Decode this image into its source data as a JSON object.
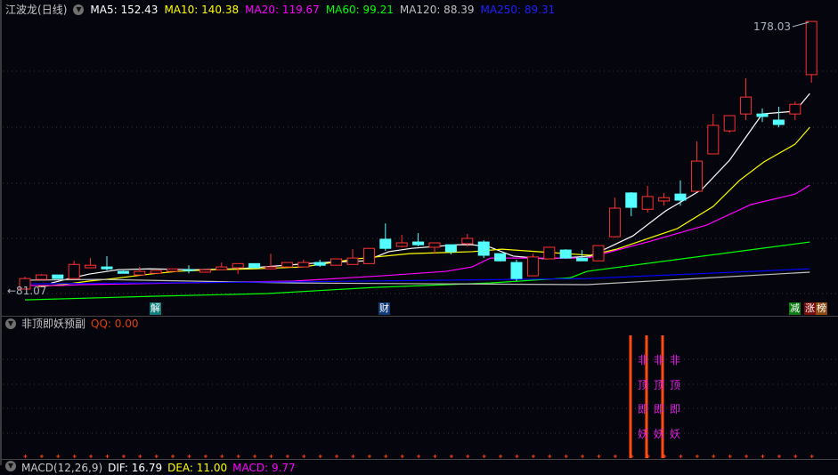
{
  "header": {
    "stock_name": "江波龙",
    "period": "(日线)",
    "ma": [
      {
        "label": "MA5: 152.43",
        "color": "#ffffff"
      },
      {
        "label": "MA10: 140.38",
        "color": "#ffff00"
      },
      {
        "label": "MA20: 119.67",
        "color": "#ff00ff"
      },
      {
        "label": "MA60: 99.21",
        "color": "#00ff00"
      },
      {
        "label": "MA120: 88.39",
        "color": "#c0c0c0"
      },
      {
        "label": "MA250: 89.31",
        "color": "#0000ff"
      }
    ]
  },
  "markers": {
    "jie": "解",
    "cai": "财",
    "jian": "减",
    "zhang": "涨",
    "bang": "榜"
  },
  "chart_data": {
    "type": "candlestick",
    "price_range": [
      77,
      180
    ],
    "high_label": "178.03",
    "low_label": "81.07",
    "up_color": "#ff3232",
    "down_color": "#54ffff",
    "candles": [
      [
        81.4,
        85.9,
        81.1,
        85.2
      ],
      [
        84.9,
        86.8,
        84.9,
        86.5
      ],
      [
        86.5,
        86.5,
        85.2,
        85.2
      ],
      [
        85.2,
        91.6,
        84.9,
        90.3
      ],
      [
        89.1,
        92.6,
        89.1,
        90.0
      ],
      [
        89.4,
        93.3,
        88.1,
        88.7
      ],
      [
        87.8,
        88.1,
        87.1,
        87.1
      ],
      [
        86.5,
        89.4,
        86.5,
        87.8
      ],
      [
        87.1,
        88.1,
        87.1,
        88.1
      ],
      [
        87.8,
        88.7,
        87.8,
        88.7
      ],
      [
        88.4,
        90.0,
        87.1,
        88.1
      ],
      [
        87.5,
        88.4,
        87.5,
        88.4
      ],
      [
        88.4,
        91.0,
        88.4,
        89.4
      ],
      [
        89.1,
        90.6,
        86.8,
        90.6
      ],
      [
        90.6,
        90.6,
        89.1,
        89.1
      ],
      [
        88.7,
        94.2,
        88.7,
        89.4
      ],
      [
        89.4,
        91.0,
        89.4,
        91.0
      ],
      [
        89.4,
        92.0,
        89.4,
        91.0
      ],
      [
        91.0,
        92.0,
        89.4,
        90.0
      ],
      [
        90.0,
        92.3,
        90.0,
        92.3
      ],
      [
        90.3,
        95.8,
        90.3,
        92.6
      ],
      [
        90.6,
        96.1,
        90.6,
        96.1
      ],
      [
        99.4,
        105.1,
        95.2,
        96.1
      ],
      [
        96.8,
        101.0,
        96.5,
        98.1
      ],
      [
        98.4,
        101.6,
        96.8,
        97.4
      ],
      [
        96.5,
        98.1,
        94.2,
        98.1
      ],
      [
        97.4,
        97.4,
        93.9,
        94.9
      ],
      [
        97.8,
        101.3,
        96.8,
        99.7
      ],
      [
        98.4,
        99.0,
        92.6,
        93.6
      ],
      [
        94.2,
        94.2,
        91.3,
        91.6
      ],
      [
        91.0,
        92.0,
        84.3,
        85.2
      ],
      [
        86.2,
        94.2,
        86.2,
        93.0
      ],
      [
        92.3,
        96.5,
        92.3,
        96.5
      ],
      [
        95.5,
        95.8,
        92.3,
        92.6
      ],
      [
        92.6,
        95.5,
        91.6,
        91.6
      ],
      [
        91.6,
        97.1,
        91.6,
        97.1
      ],
      [
        100.3,
        114.4,
        100.0,
        110.6
      ],
      [
        116.1,
        116.4,
        107.7,
        110.9
      ],
      [
        110.2,
        118.6,
        109.0,
        114.8
      ],
      [
        113.2,
        116.1,
        111.5,
        114.4
      ],
      [
        115.7,
        120.6,
        111.5,
        113.5
      ],
      [
        116.7,
        134.7,
        116.7,
        127.6
      ],
      [
        130.2,
        144.6,
        130.2,
        140.5
      ],
      [
        138.5,
        144.0,
        137.9,
        144.0
      ],
      [
        144.6,
        157.5,
        142.4,
        150.7
      ],
      [
        144.6,
        146.6,
        141.7,
        143.7
      ],
      [
        142.4,
        147.2,
        139.8,
        140.8
      ],
      [
        144.6,
        149.1,
        142.4,
        148.1
      ],
      [
        158.8,
        178.03,
        155.9,
        178.0
      ]
    ],
    "ma_series": [
      {
        "name": "MA5",
        "color": "#ffffff",
        "points": [
          [
            1.6,
            83.6
          ],
          [
            2.7,
            85.2
          ],
          [
            3.9,
            86.8
          ],
          [
            5.7,
            88.4
          ],
          [
            7.6,
            88.7
          ],
          [
            10.4,
            88.4
          ],
          [
            13,
            88.7
          ],
          [
            16.6,
            90.3
          ],
          [
            18.2,
            91.0
          ],
          [
            20.8,
            91.6
          ],
          [
            22.2,
            94.9
          ],
          [
            23.6,
            96.1
          ],
          [
            26.4,
            97.4
          ],
          [
            27.3,
            97.4
          ],
          [
            28.4,
            96.5
          ],
          [
            29.8,
            93.3
          ],
          [
            31.8,
            92.3
          ],
          [
            34.5,
            93.3
          ],
          [
            37.1,
            100.6
          ],
          [
            39.1,
            109.6
          ],
          [
            41.3,
            117.3
          ],
          [
            43,
            127.9
          ],
          [
            45,
            144.6
          ],
          [
            47,
            145.6
          ],
          [
            47.9,
            152.0
          ]
        ]
      },
      {
        "name": "MA10",
        "color": "#ffff00",
        "points": [
          [
            0.8,
            82.3
          ],
          [
            2.3,
            83.0
          ],
          [
            3.9,
            84.3
          ],
          [
            5.4,
            85.2
          ],
          [
            7.6,
            86.8
          ],
          [
            9.3,
            87.8
          ],
          [
            11.5,
            88.4
          ],
          [
            13.9,
            88.7
          ],
          [
            17,
            89.4
          ],
          [
            20.2,
            92.3
          ],
          [
            23.5,
            94.2
          ],
          [
            27.3,
            94.9
          ],
          [
            29.1,
            95.8
          ],
          [
            34.5,
            93.6
          ],
          [
            36.1,
            95.8
          ],
          [
            39.8,
            103.2
          ],
          [
            42,
            111.2
          ],
          [
            43.6,
            120.6
          ],
          [
            45.1,
            127.3
          ],
          [
            47,
            133.7
          ],
          [
            47.9,
            139.8
          ]
        ]
      },
      {
        "name": "MA20",
        "color": "#ff00ff",
        "points": [
          [
            0,
            82.7
          ],
          [
            2.3,
            82.7
          ],
          [
            3.4,
            83.0
          ],
          [
            9.3,
            83.6
          ],
          [
            16.4,
            84.3
          ],
          [
            21.8,
            86.2
          ],
          [
            25.7,
            87.8
          ],
          [
            27.3,
            89.4
          ],
          [
            28.4,
            92.6
          ],
          [
            34.3,
            92.6
          ],
          [
            38,
            98.4
          ],
          [
            41.6,
            104.5
          ],
          [
            44.3,
            111.9
          ],
          [
            47,
            115.7
          ],
          [
            47.9,
            118.9
          ]
        ]
      },
      {
        "name": "MA60",
        "color": "#00ff00",
        "points": [
          [
            0,
            77.5
          ],
          [
            7.7,
            78.8
          ],
          [
            14.8,
            79.8
          ],
          [
            21.3,
            82.0
          ],
          [
            28.4,
            83.6
          ],
          [
            33.3,
            85.5
          ],
          [
            34.3,
            87.8
          ],
          [
            47.9,
            98.4
          ]
        ]
      },
      {
        "name": "MA120",
        "color": "#c0c0c0",
        "points": [
          [
            0,
            84.6
          ],
          [
            4.5,
            84.9
          ],
          [
            16.4,
            83.6
          ],
          [
            34.3,
            83.0
          ],
          [
            47.9,
            87.5
          ]
        ]
      },
      {
        "name": "MA250",
        "color": "#0000ff",
        "points": [
          [
            0,
            83.3
          ],
          [
            16.4,
            84.0
          ],
          [
            34.3,
            85.2
          ],
          [
            47.9,
            88.7
          ]
        ]
      }
    ]
  },
  "indicator": {
    "name": "非顶即妖预副",
    "qq_label": "QQ: 0.00",
    "signal_chars": [
      "非",
      "顶",
      "即",
      "妖"
    ],
    "signal_count": 3
  },
  "macd": {
    "name": "MACD(12,26,9)",
    "dif": "DIF: 16.79",
    "dea": "DEA: 11.00",
    "macd": "MACD: 9.77"
  }
}
